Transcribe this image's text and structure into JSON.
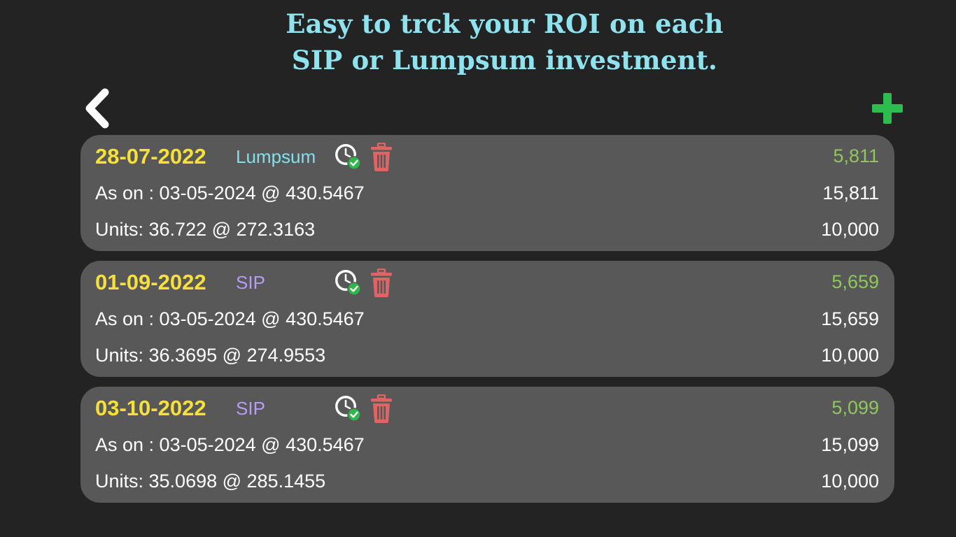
{
  "headline": {
    "line1": "Easy to trck your ROI on each",
    "line2": "SIP or Lumpsum investment."
  },
  "nav": {
    "back_icon": "chevron-left-icon",
    "add_icon": "plus-icon",
    "add_color": "#2dbd4e"
  },
  "colors": {
    "background": "#232323",
    "card": "#585858",
    "headline": "#8ee3ef",
    "date": "#f7e03a",
    "lumpsum": "#7fe0ee",
    "sip": "#b79cf2",
    "gain": "#8fc85a",
    "trash": "#e06464"
  },
  "investments": [
    {
      "date": "28-07-2022",
      "type": "Lumpsum",
      "as_on": "As on : 03-05-2024 @ 430.5467",
      "units": "Units: 36.722 @ 272.3163",
      "gain": "5,811",
      "current_value": "15,811",
      "invested": "10,000"
    },
    {
      "date": "01-09-2022",
      "type": "SIP",
      "as_on": "As on : 03-05-2024 @ 430.5467",
      "units": "Units: 36.3695 @ 274.9553",
      "gain": "5,659",
      "current_value": "15,659",
      "invested": "10,000"
    },
    {
      "date": "03-10-2022",
      "type": "SIP",
      "as_on": "As on : 03-05-2024 @ 430.5467",
      "units": "Units: 35.0698 @ 285.1455",
      "gain": "5,099",
      "current_value": "15,099",
      "invested": "10,000"
    }
  ]
}
